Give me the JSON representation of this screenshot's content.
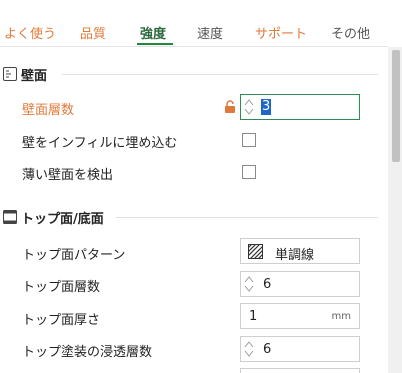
{
  "tabs": [
    {
      "label": "よく使う",
      "state": "accent"
    },
    {
      "label": "品質",
      "state": "accent"
    },
    {
      "label": "強度",
      "state": "active"
    },
    {
      "label": "速度",
      "state": "plain"
    },
    {
      "label": "サポート",
      "state": "accent"
    },
    {
      "label": "その他",
      "state": "plain"
    }
  ],
  "sections": {
    "wall": {
      "title": "壁面",
      "rows": {
        "wall_layers": {
          "label": "壁面層数",
          "value": "3"
        },
        "embed_infill": {
          "label": "壁をインフィルに埋め込む",
          "checked": false
        },
        "detect_thin": {
          "label": "薄い壁面を検出",
          "checked": false
        }
      }
    },
    "topbottom": {
      "title": "トップ面/底面",
      "rows": {
        "top_pattern": {
          "label": "トップ面パターン",
          "value": "単調線"
        },
        "top_layers": {
          "label": "トップ面層数",
          "value": "6"
        },
        "top_thickness": {
          "label": "トップ面厚さ",
          "value": "1",
          "unit": "mm"
        },
        "top_paint_layers": {
          "label": "トップ塗装の浸透層数",
          "value": "6"
        }
      }
    }
  },
  "colors": {
    "accent": "#e07a3a",
    "active_tab": "#2b6a3f",
    "focus_border": "#2e8b57",
    "selection": "#1e66c8"
  },
  "icons": {
    "wall_section": "wall-icon",
    "topbottom_section": "top-bottom-icon",
    "lock": "unlock-icon",
    "pattern": "monotonic-pattern-icon"
  }
}
